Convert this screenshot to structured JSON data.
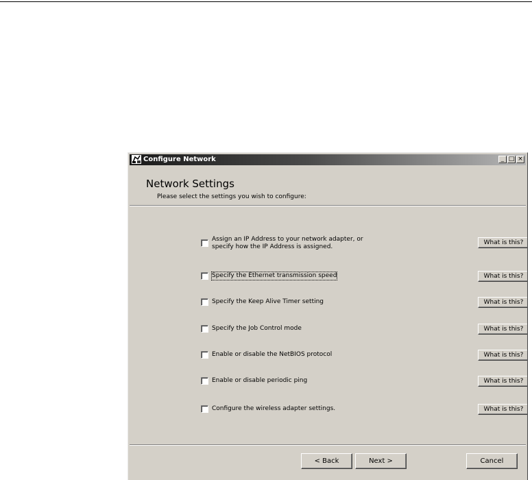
{
  "window": {
    "title": "Configure Network",
    "controls": {
      "minimize": "_",
      "maximize": "□",
      "close": "×"
    }
  },
  "header": {
    "title": "Network Settings",
    "subtitle": "Please select the settings you wish to configure:"
  },
  "options": [
    {
      "label": "Assign an IP Address to your network adapter, or\nspecify how the IP Address is assigned.",
      "checked": false,
      "help_label": "What is this?"
    },
    {
      "label": "Specify the Ethernet transmission speed",
      "checked": false,
      "help_label": "What is this?"
    },
    {
      "label": "Specify the Keep Alive Timer setting",
      "checked": false,
      "help_label": "What is this?"
    },
    {
      "label": "Specify the Job Control mode",
      "checked": false,
      "help_label": "What is this?"
    },
    {
      "label": "Enable or disable the NetBIOS protocol",
      "checked": false,
      "help_label": "What is this?"
    },
    {
      "label": "Enable or disable periodic ping",
      "checked": false,
      "help_label": "What is this?"
    },
    {
      "label": "Configure the wireless adapter settings.",
      "checked": false,
      "help_label": "What is this?"
    }
  ],
  "footer": {
    "back_label": "< Back",
    "next_label": "Next >",
    "cancel_label": "Cancel"
  }
}
